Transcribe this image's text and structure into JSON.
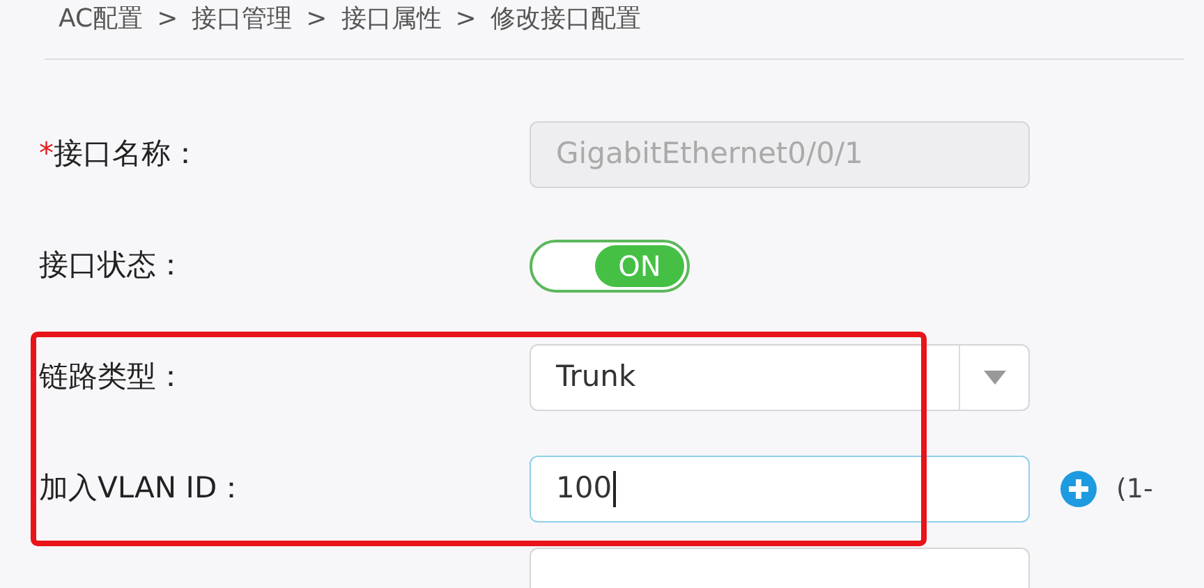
{
  "breadcrumb": {
    "items": [
      "AC配置",
      "接口管理",
      "接口属性",
      "修改接口配置"
    ],
    "separator": ">"
  },
  "fields": [
    {
      "kind": "text",
      "label": "接口名称：",
      "required_mark": "*",
      "value": "GigabitEthernet0/0/1",
      "disabled": true
    },
    {
      "kind": "toggle",
      "label": "接口状态：",
      "on": true,
      "toggle_label": "ON"
    },
    {
      "kind": "select",
      "label": "链路类型：",
      "value": "Trunk",
      "highlighted": true
    },
    {
      "kind": "input",
      "label": "加入VLAN ID：",
      "value": "100",
      "focused": true,
      "highlighted": true,
      "hint": "(1-"
    },
    {
      "kind": "empty"
    }
  ]
}
